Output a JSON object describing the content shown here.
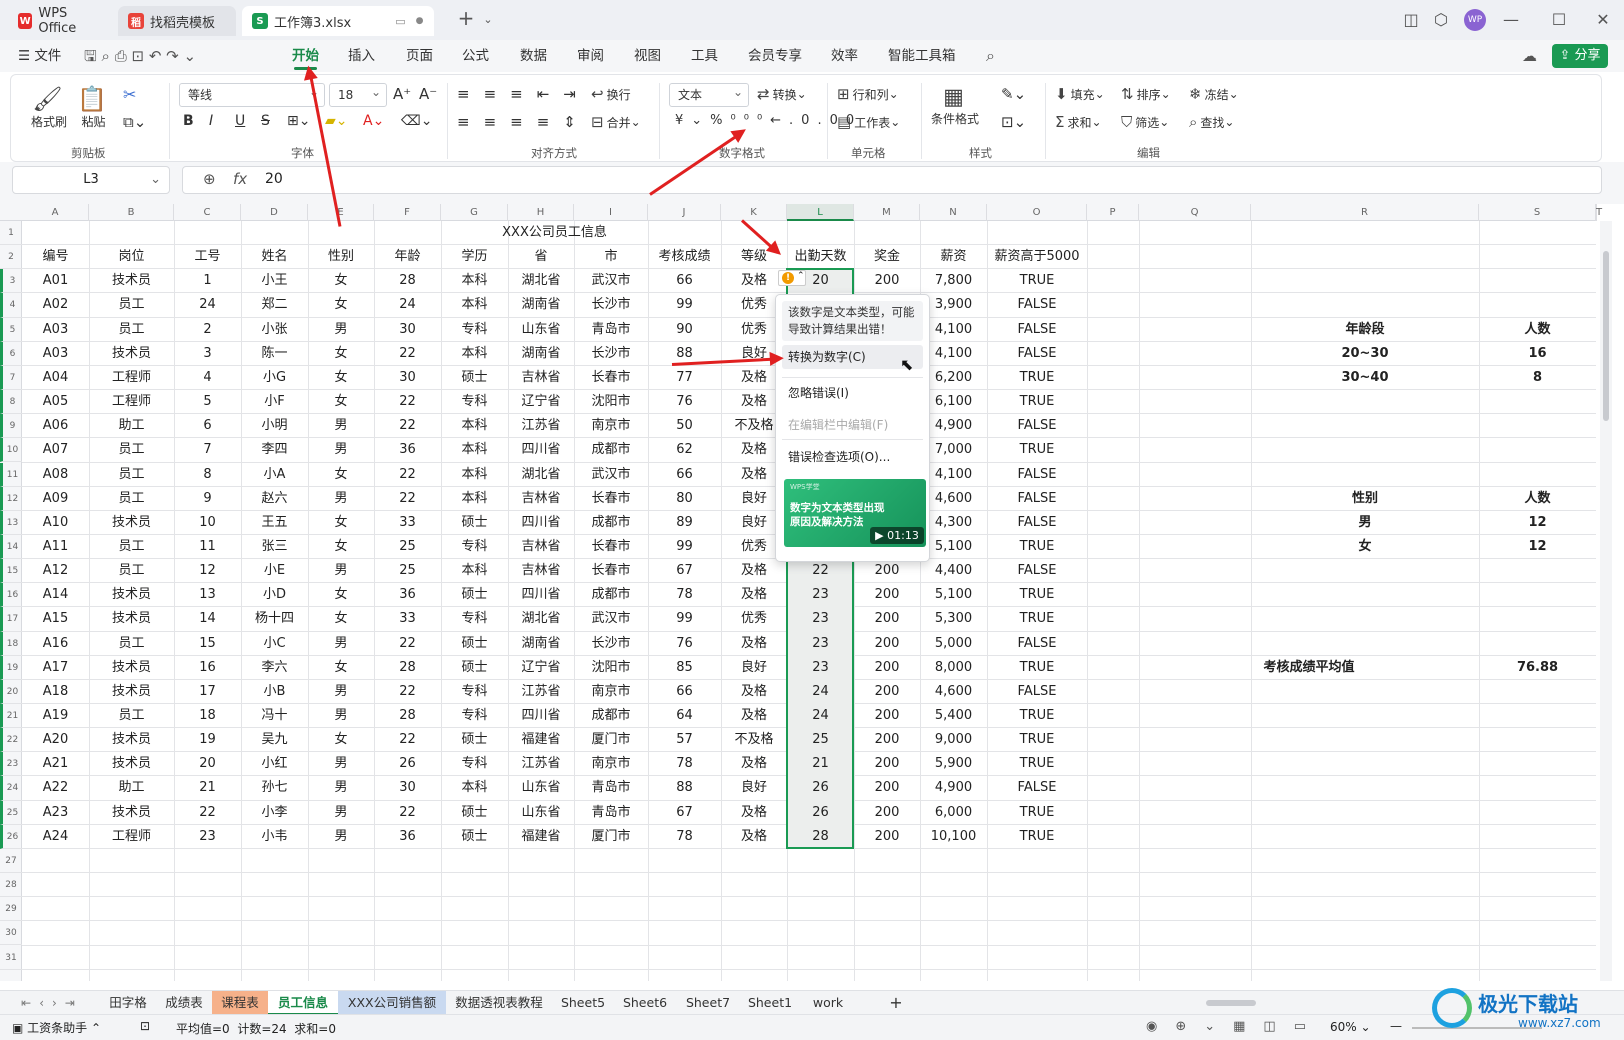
{
  "titlebar": {
    "tabs": [
      "WPS Office",
      "找稻壳模板",
      "工作簿3.xlsx"
    ],
    "avatar": "WP"
  },
  "menu": {
    "file": "文件",
    "items": [
      "开始",
      "插入",
      "页面",
      "公式",
      "数据",
      "审阅",
      "视图",
      "工具",
      "会员专享",
      "效率",
      "智能工具箱"
    ],
    "active": "开始",
    "share": "分享"
  },
  "ribbon": {
    "clipboard": {
      "format_painter": "格式刷",
      "paste": "粘贴",
      "group": "剪贴板"
    },
    "font": {
      "name": "等线",
      "size": "18",
      "group": "字体"
    },
    "align": {
      "wrap": "换行",
      "merge": "合并",
      "group": "对齐方式"
    },
    "number": {
      "format": "文本",
      "convert": "转换",
      "group": "数字格式"
    },
    "cells": {
      "rowcol": "行和列",
      "sheet": "工作表",
      "group": "单元格"
    },
    "styles": {
      "cond": "条件格式",
      "group": "样式"
    },
    "edit": {
      "fill": "填充",
      "sort": "排序",
      "freeze": "冻结",
      "sum": "求和",
      "filter": "筛选",
      "find": "查找",
      "group": "编辑"
    }
  },
  "formula": {
    "cellref": "L3",
    "fx": "fx",
    "value": "20"
  },
  "columns": [
    "A",
    "B",
    "C",
    "D",
    "E",
    "F",
    "G",
    "H",
    "I",
    "J",
    "K",
    "L",
    "M",
    "N",
    "O",
    "P",
    "Q",
    "R",
    "S",
    "T"
  ],
  "sheet_title": "XXX公司员工信息",
  "headers": [
    "编号",
    "岗位",
    "工号",
    "姓名",
    "性别",
    "年龄",
    "学历",
    "省",
    "市",
    "考核成绩",
    "等级",
    "出勤天数",
    "奖金",
    "薪资",
    "薪资高于5000"
  ],
  "rows": [
    [
      "A01",
      "技术员",
      "1",
      "小王",
      "女",
      "28",
      "本科",
      "湖北省",
      "武汉市",
      "66",
      "及格",
      "20",
      "200",
      "7,800",
      "TRUE"
    ],
    [
      "A02",
      "员工",
      "24",
      "郑二",
      "女",
      "24",
      "本科",
      "湖南省",
      "长沙市",
      "99",
      "优秀",
      "",
      "",
      "3,900",
      "FALSE"
    ],
    [
      "A03",
      "员工",
      "2",
      "小张",
      "男",
      "30",
      "专科",
      "山东省",
      "青岛市",
      "90",
      "优秀",
      "",
      "",
      "4,100",
      "FALSE"
    ],
    [
      "A03",
      "技术员",
      "3",
      "陈一",
      "女",
      "22",
      "本科",
      "湖南省",
      "长沙市",
      "88",
      "良好",
      "",
      "",
      "4,100",
      "FALSE"
    ],
    [
      "A04",
      "工程师",
      "4",
      "小G",
      "女",
      "30",
      "硕士",
      "吉林省",
      "长春市",
      "77",
      "及格",
      "",
      "",
      "6,200",
      "TRUE"
    ],
    [
      "A05",
      "工程师",
      "5",
      "小F",
      "女",
      "22",
      "专科",
      "辽宁省",
      "沈阳市",
      "76",
      "及格",
      "",
      "",
      "6,100",
      "TRUE"
    ],
    [
      "A06",
      "助工",
      "6",
      "小明",
      "男",
      "22",
      "本科",
      "江苏省",
      "南京市",
      "50",
      "不及格",
      "",
      "",
      "4,900",
      "FALSE"
    ],
    [
      "A07",
      "员工",
      "7",
      "李四",
      "男",
      "36",
      "本科",
      "四川省",
      "成都市",
      "62",
      "及格",
      "",
      "",
      "7,000",
      "TRUE"
    ],
    [
      "A08",
      "员工",
      "8",
      "小A",
      "女",
      "22",
      "本科",
      "湖北省",
      "武汉市",
      "66",
      "及格",
      "",
      "",
      "4,100",
      "FALSE"
    ],
    [
      "A09",
      "员工",
      "9",
      "赵六",
      "男",
      "22",
      "本科",
      "吉林省",
      "长春市",
      "80",
      "良好",
      "",
      "",
      "4,600",
      "FALSE"
    ],
    [
      "A10",
      "技术员",
      "10",
      "王五",
      "女",
      "33",
      "硕士",
      "四川省",
      "成都市",
      "89",
      "良好",
      "",
      "",
      "4,300",
      "FALSE"
    ],
    [
      "A11",
      "员工",
      "11",
      "张三",
      "女",
      "25",
      "专科",
      "吉林省",
      "长春市",
      "99",
      "优秀",
      "22",
      "200",
      "5,100",
      "TRUE"
    ],
    [
      "A12",
      "员工",
      "12",
      "小E",
      "男",
      "25",
      "本科",
      "吉林省",
      "长春市",
      "67",
      "及格",
      "22",
      "200",
      "4,400",
      "FALSE"
    ],
    [
      "A14",
      "技术员",
      "13",
      "小D",
      "女",
      "36",
      "硕士",
      "四川省",
      "成都市",
      "78",
      "及格",
      "23",
      "200",
      "5,100",
      "TRUE"
    ],
    [
      "A15",
      "技术员",
      "14",
      "杨十四",
      "女",
      "33",
      "专科",
      "湖北省",
      "武汉市",
      "99",
      "优秀",
      "23",
      "200",
      "5,300",
      "TRUE"
    ],
    [
      "A16",
      "员工",
      "15",
      "小C",
      "男",
      "22",
      "硕士",
      "湖南省",
      "长沙市",
      "76",
      "及格",
      "23",
      "200",
      "5,000",
      "FALSE"
    ],
    [
      "A17",
      "技术员",
      "16",
      "李六",
      "女",
      "28",
      "硕士",
      "辽宁省",
      "沈阳市",
      "85",
      "良好",
      "23",
      "200",
      "8,000",
      "TRUE"
    ],
    [
      "A18",
      "技术员",
      "17",
      "小B",
      "男",
      "22",
      "专科",
      "江苏省",
      "南京市",
      "66",
      "及格",
      "24",
      "200",
      "4,600",
      "FALSE"
    ],
    [
      "A19",
      "员工",
      "18",
      "冯十",
      "男",
      "28",
      "专科",
      "四川省",
      "成都市",
      "64",
      "及格",
      "24",
      "200",
      "5,400",
      "TRUE"
    ],
    [
      "A20",
      "技术员",
      "19",
      "吴九",
      "女",
      "22",
      "硕士",
      "福建省",
      "厦门市",
      "57",
      "不及格",
      "25",
      "200",
      "9,000",
      "TRUE"
    ],
    [
      "A21",
      "技术员",
      "20",
      "小红",
      "男",
      "26",
      "专科",
      "江苏省",
      "南京市",
      "78",
      "及格",
      "21",
      "200",
      "5,900",
      "TRUE"
    ],
    [
      "A22",
      "助工",
      "21",
      "孙七",
      "男",
      "30",
      "本科",
      "山东省",
      "青岛市",
      "88",
      "良好",
      "26",
      "200",
      "4,900",
      "FALSE"
    ],
    [
      "A23",
      "技术员",
      "22",
      "小李",
      "男",
      "22",
      "硕士",
      "山东省",
      "青岛市",
      "67",
      "及格",
      "26",
      "200",
      "6,000",
      "TRUE"
    ],
    [
      "A24",
      "工程师",
      "23",
      "小韦",
      "男",
      "36",
      "硕士",
      "福建省",
      "厦门市",
      "78",
      "及格",
      "28",
      "200",
      "10,100",
      "TRUE"
    ]
  ],
  "summary": {
    "age_header": [
      "年龄段",
      "人数"
    ],
    "age_rows": [
      [
        "20~30",
        "16"
      ],
      [
        "30~40",
        "8"
      ]
    ],
    "gender_header": [
      "性别",
      "人数"
    ],
    "gender_rows": [
      [
        "男",
        "12"
      ],
      [
        "女",
        "12"
      ]
    ],
    "avg_label": "考核成绩平均值",
    "avg_value": "76.88"
  },
  "popup": {
    "warning": "该数字是文本类型，可能导致计算结果出错！",
    "convert": "转换为数字(C)",
    "ignore": "忽略错误(I)",
    "edit_in_bar": "在编辑栏中编辑(F)",
    "options": "错误检查选项(O)...",
    "video_brand": "WPS学堂",
    "video_title": "数字为文本类型出现原因及解决方法",
    "video_time": "01:13"
  },
  "sheets": [
    "田字格",
    "成绩表",
    "课程表",
    "员工信息",
    "XXX公司销售额",
    "数据透视表教程",
    "Sheet5",
    "Sheet6",
    "Sheet7",
    "Sheet1",
    "work"
  ],
  "active_sheet": "员工信息",
  "status": {
    "assistant": "工资条助手",
    "stats": "平均值=0  计数=24  求和=0",
    "zoom": "60%"
  },
  "watermark": "极光下载站",
  "watermark_url": "www.xz7.com"
}
